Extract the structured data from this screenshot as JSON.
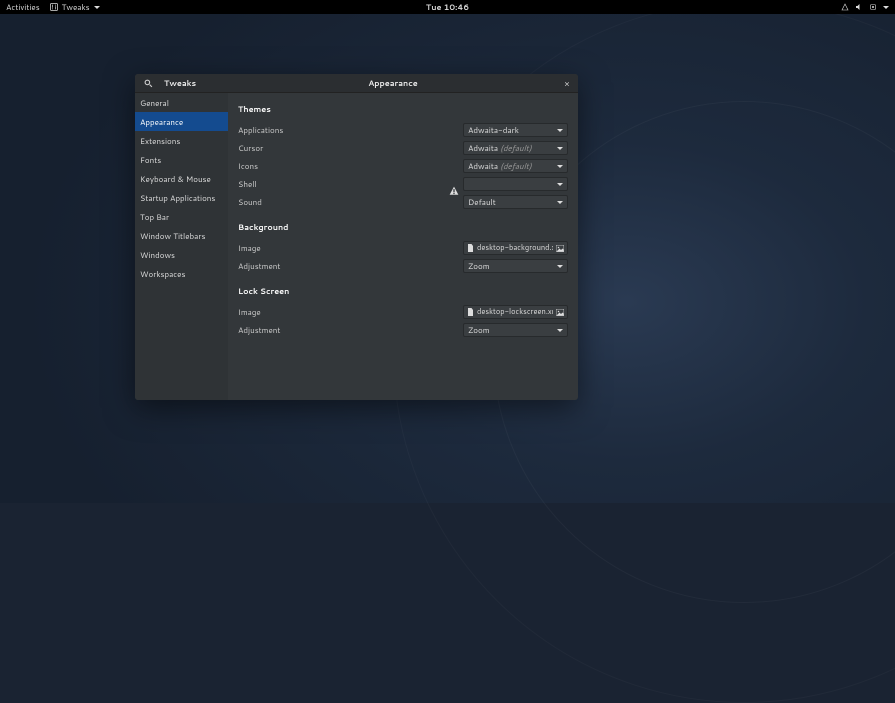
{
  "topbar": {
    "activities": "Activities",
    "app_name": "Tweaks",
    "clock": "Tue 10:46"
  },
  "window": {
    "app_title": "Tweaks",
    "page_title": "Appearance",
    "close": "×"
  },
  "sidebar": {
    "items": [
      {
        "label": "General"
      },
      {
        "label": "Appearance"
      },
      {
        "label": "Extensions"
      },
      {
        "label": "Fonts"
      },
      {
        "label": "Keyboard & Mouse"
      },
      {
        "label": "Startup Applications"
      },
      {
        "label": "Top Bar"
      },
      {
        "label": "Window Titlebars"
      },
      {
        "label": "Windows"
      },
      {
        "label": "Workspaces"
      }
    ],
    "selected_index": 1
  },
  "themes": {
    "heading": "Themes",
    "applications": {
      "label": "Applications",
      "value": "Adwaita-dark",
      "default": ""
    },
    "cursor": {
      "label": "Cursor",
      "value": "Adwaita",
      "default": "(default)"
    },
    "icons": {
      "label": "Icons",
      "value": "Adwaita",
      "default": "(default)"
    },
    "shell": {
      "label": "Shell",
      "value": "",
      "default": ""
    },
    "sound": {
      "label": "Sound",
      "value": "Default",
      "default": ""
    }
  },
  "background": {
    "heading": "Background",
    "image": {
      "label": "Image",
      "file": "desktop-background.xml"
    },
    "adjustment": {
      "label": "Adjustment",
      "value": "Zoom"
    }
  },
  "lockscreen": {
    "heading": "Lock Screen",
    "image": {
      "label": "Image",
      "file": "desktop-lockscreen.xml"
    },
    "adjustment": {
      "label": "Adjustment",
      "value": "Zoom"
    }
  }
}
